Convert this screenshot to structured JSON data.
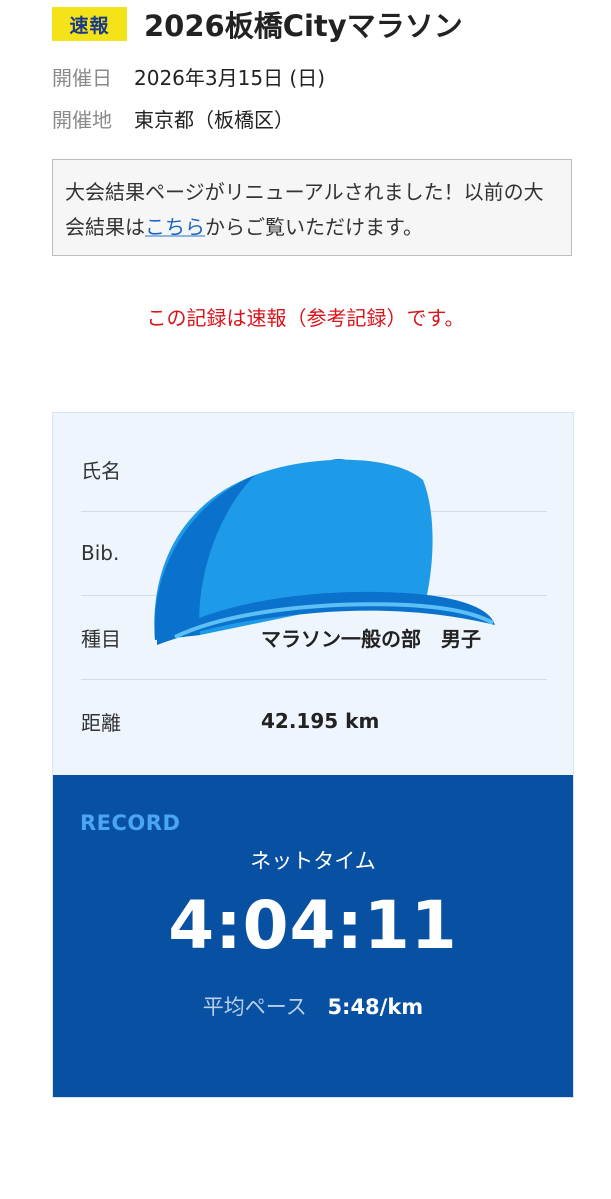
{
  "header": {
    "badge": "速報",
    "title": "2026板橋Cityマラソン"
  },
  "event": {
    "date_label": "開催日",
    "date_value": "2026年3月15日 (日)",
    "venue_label": "開催地",
    "venue_value": "東京都（板橋区）"
  },
  "notice": {
    "text_before_link": "大会結果ページがリニューアルされました！以前の大会結果は",
    "link_text": "こちら",
    "text_after_link": "からご覧いただけます。"
  },
  "warning": "この記録は速報（参考記録）です。",
  "info": {
    "rows": [
      {
        "label": "氏名",
        "value": ""
      },
      {
        "label": "Bib.",
        "value": ""
      },
      {
        "label": "種目",
        "value": "マラソン一般の部　男子"
      },
      {
        "label": "距離",
        "value": "42.195 km"
      }
    ],
    "overlay_icon": "baseball-cap-icon"
  },
  "record": {
    "label": "RECORD",
    "net_label": "ネットタイム",
    "net_time": "4:04:11",
    "pace_label": "平均ペース",
    "pace_value": "5:48/km"
  },
  "colors": {
    "badge_bg": "#f5e31a",
    "warning": "#d9141b",
    "link": "#1a66c4",
    "info_bg": "#eef5fd",
    "record_bg": "#0850a1",
    "record_label": "#4aa6f2",
    "cap_main": "#1e9be8",
    "cap_shadow": "#0a72cc"
  }
}
